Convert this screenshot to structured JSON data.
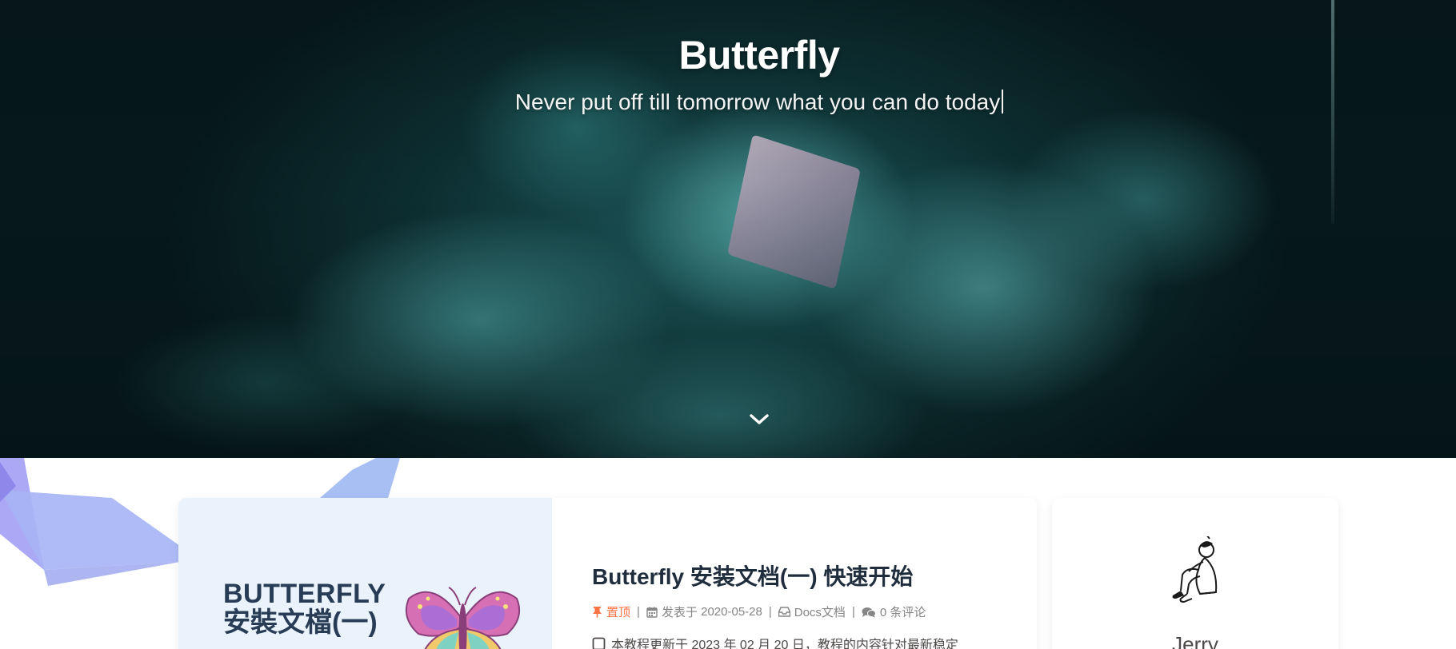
{
  "hero": {
    "title": "Butterfly",
    "subtitle": "Never put off till tomorrow what you can do today",
    "scroll_icon": "chevron-down-icon",
    "accent_color": "#2a7f80"
  },
  "post": {
    "cover": {
      "line1": "BUTTERFLY",
      "line2": "安裝文檔(一)",
      "image_icon": "butterfly-illustration"
    },
    "title": "Butterfly 安装文档(一) 快速开始",
    "sticky_label": "置顶",
    "date_label": "发表于",
    "date": "2020-05-28",
    "category": "Docs文档",
    "comments": "0 条评论",
    "excerpt": "本教程更新于 2023 年 02 月 20 日，教程的内容针对最新稳定",
    "sticky_color": "#ff7242"
  },
  "author": {
    "name": "Jerry",
    "avatar_icon": "avatar-sketch"
  }
}
